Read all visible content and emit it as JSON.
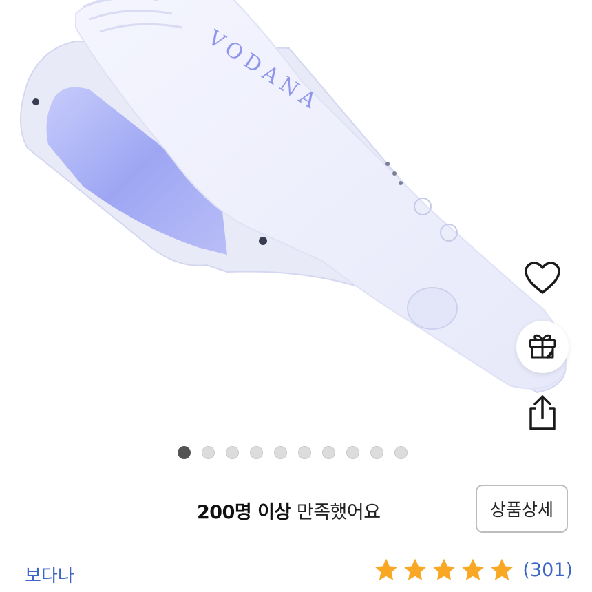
{
  "product_image": {
    "brand_logo": "VODANA"
  },
  "actions": {
    "like_icon": "heart-icon",
    "gift_icon": "gift-icon",
    "share_icon": "share-icon"
  },
  "carousel": {
    "total": 10,
    "active_index": 0
  },
  "satisfaction": {
    "strong": "200명 이상",
    "normal": " 만족했어요"
  },
  "detail_button": {
    "label": "상품상세"
  },
  "brand_name": "보다나",
  "rating": {
    "stars": 5,
    "max": 5,
    "count": "(301)"
  },
  "colors": {
    "link": "#3d66c4",
    "star": "#f9a825",
    "device_body": "#eef0fb",
    "plate": "#a9b0f2"
  }
}
